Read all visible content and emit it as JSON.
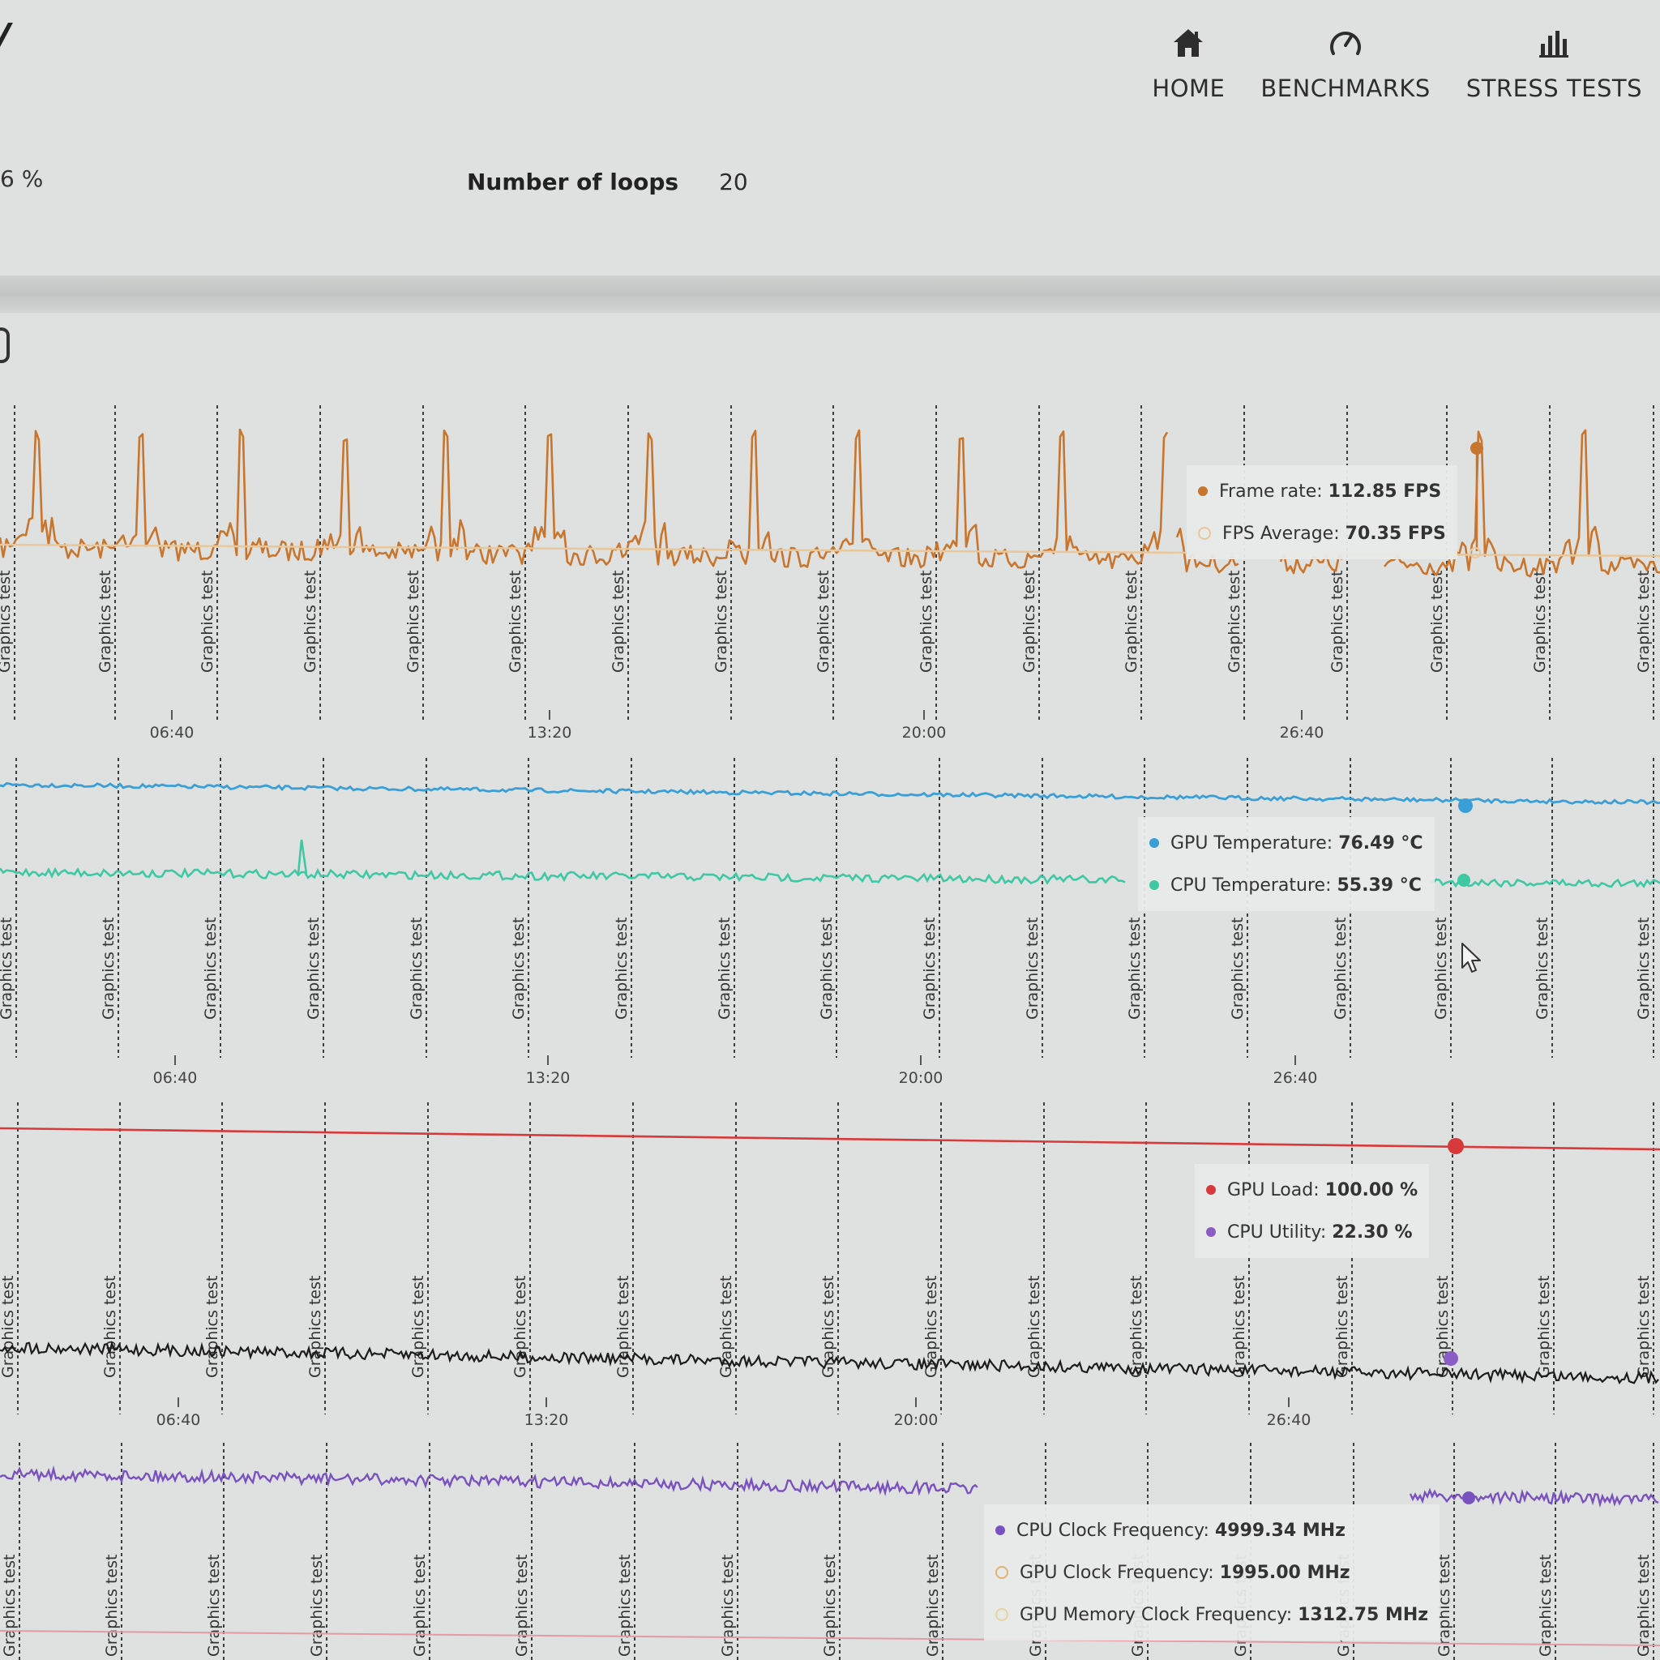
{
  "nav": {
    "items": [
      {
        "label": "HOME",
        "icon": "home-icon"
      },
      {
        "label": "BENCHMARKS",
        "icon": "speedometer-icon"
      },
      {
        "label": "STRESS TESTS",
        "icon": "bar-chart-icon"
      }
    ]
  },
  "stats": {
    "partial_value": "6 %",
    "loops_label": "Number of loops",
    "loops_value": "20"
  },
  "tooltips": {
    "fps": [
      {
        "name": "Frame rate",
        "value": "112.85 FPS",
        "color": "#c8752e",
        "hollow": false
      },
      {
        "name": "FPS Average",
        "value": "70.35 FPS",
        "color": "#e8c79a",
        "hollow": true
      }
    ],
    "temp": [
      {
        "name": "GPU Temperature",
        "value": "76.49 °C",
        "color": "#3a9fd6",
        "hollow": false
      },
      {
        "name": "CPU Temperature",
        "value": "55.39 °C",
        "color": "#3ec8a4",
        "hollow": false
      }
    ],
    "load": [
      {
        "name": "GPU Load",
        "value": "100.00 %",
        "color": "#d63a3a",
        "hollow": false
      },
      {
        "name": "CPU Utility",
        "value": "22.30 %",
        "color": "#8a5cc4",
        "hollow": false
      }
    ],
    "clock": [
      {
        "name": "CPU Clock Frequency",
        "value": "4999.34 MHz",
        "color": "#7a52c0",
        "hollow": false
      },
      {
        "name": "GPU Clock Frequency",
        "value": "1995.00 MHz",
        "color": "#e0b070",
        "hollow": true
      },
      {
        "name": "GPU Memory Clock Frequency",
        "value": "1312.75 MHz",
        "color": "#e8d3a0",
        "hollow": true
      }
    ]
  },
  "chart_data": [
    {
      "type": "line",
      "series": [
        {
          "name": "Frame rate",
          "color": "#c8752e",
          "baseline": 70,
          "peak": 113
        },
        {
          "name": "FPS Average",
          "color": "#e8c79a",
          "values": [
            70.35
          ]
        }
      ],
      "marker_label": "Graphics test",
      "marker_count": 17,
      "x_ticks": [
        "06:40",
        "13:20",
        "20:00",
        "26:40"
      ]
    },
    {
      "type": "line",
      "series": [
        {
          "name": "GPU Temperature",
          "color": "#3a9fd6",
          "values": [
            76.49
          ]
        },
        {
          "name": "CPU Temperature",
          "color": "#3ec8a4",
          "values": [
            55.39
          ]
        }
      ],
      "marker_label": "Graphics test",
      "marker_count": 17,
      "x_ticks": [
        "06:40",
        "13:20",
        "20:00",
        "26:40"
      ]
    },
    {
      "type": "line",
      "series": [
        {
          "name": "GPU Load",
          "color": "#d63a3a",
          "values": [
            100.0
          ]
        },
        {
          "name": "CPU Utility",
          "color": "#1c1c1c",
          "values": [
            22.3
          ]
        }
      ],
      "marker_label": "Graphics test",
      "marker_count": 17,
      "x_ticks": [
        "06:40",
        "13:20",
        "20:00",
        "26:40"
      ]
    },
    {
      "type": "line",
      "series": [
        {
          "name": "CPU Clock Frequency",
          "color": "#7a52c0",
          "values": [
            4999.34
          ]
        },
        {
          "name": "GPU Clock Frequency",
          "color": "#e0b070",
          "values": [
            1995.0
          ]
        },
        {
          "name": "GPU Memory Clock Frequency",
          "color": "#e8d3a0",
          "values": [
            1312.75
          ]
        }
      ],
      "marker_label": "Graphics test",
      "marker_count": 17
    }
  ]
}
